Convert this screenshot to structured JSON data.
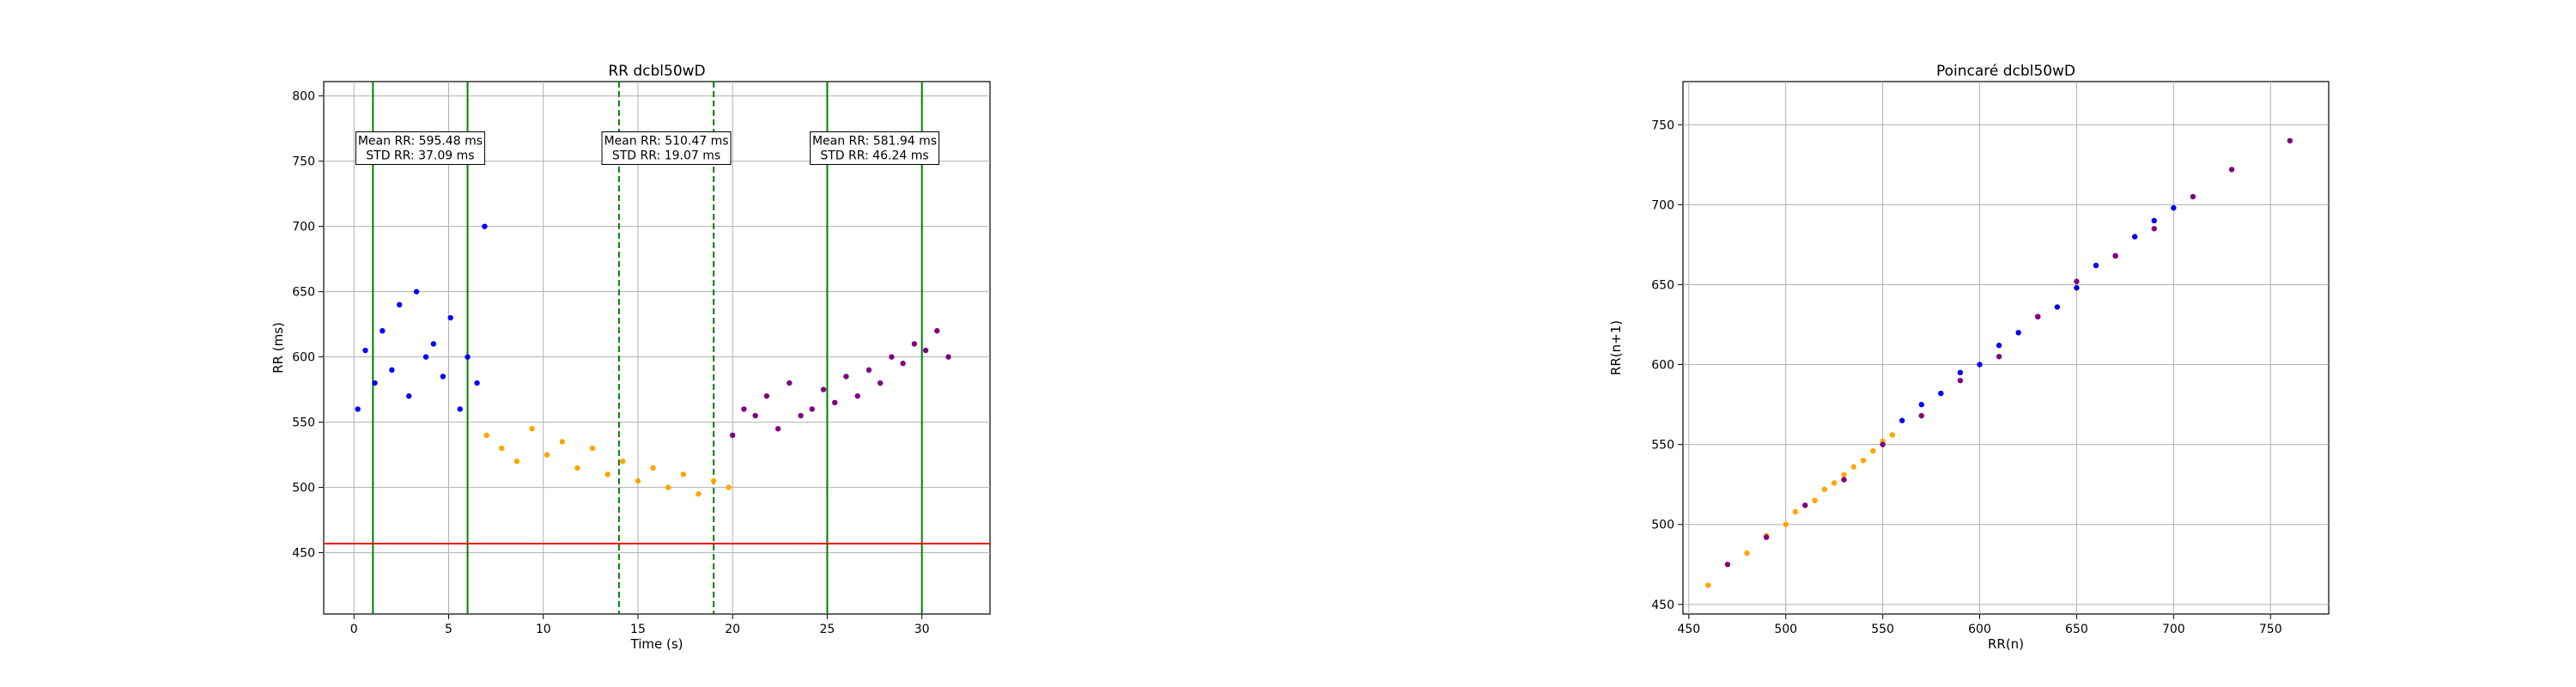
{
  "chart_data": [
    {
      "type": "scatter",
      "title": "RR dcbl50wD",
      "xlabel": "Time (s)",
      "ylabel": "RR (ms)",
      "xlim": [
        -1.6,
        33.6
      ],
      "ylim": [
        403,
        811
      ],
      "xticks": [
        0,
        5,
        10,
        15,
        20,
        25,
        30
      ],
      "yticks": [
        450,
        500,
        550,
        600,
        650,
        700,
        750,
        800
      ],
      "grid": true,
      "threshold_line": {
        "y": 457,
        "color": "#ff0000"
      },
      "vertical_lines": [
        {
          "x": 1,
          "style": "solid",
          "color": "#008000"
        },
        {
          "x": 6,
          "style": "solid",
          "color": "#008000"
        },
        {
          "x": 14,
          "style": "dashed",
          "color": "#008000"
        },
        {
          "x": 19,
          "style": "dashed",
          "color": "#008000"
        },
        {
          "x": 25,
          "style": "solid",
          "color": "#008000"
        },
        {
          "x": 30,
          "style": "solid",
          "color": "#008000"
        }
      ],
      "annotations": [
        {
          "x": 3.5,
          "y": 760,
          "lines": [
            "Mean RR: 595.48 ms",
            "STD RR: 37.09 ms"
          ]
        },
        {
          "x": 16.5,
          "y": 760,
          "lines": [
            "Mean RR: 510.47 ms",
            "STD RR: 19.07 ms"
          ]
        },
        {
          "x": 27.5,
          "y": 760,
          "lines": [
            "Mean RR: 581.94 ms",
            "STD RR: 46.24 ms"
          ]
        }
      ],
      "series": [
        {
          "color": "#0000ff",
          "x": [
            0.2,
            0.6,
            1.1,
            1.5,
            2.0,
            2.4,
            2.9,
            3.3,
            3.8,
            4.2,
            4.7,
            5.1,
            5.6,
            6.0,
            6.5,
            6.9
          ],
          "y": [
            560,
            605,
            580,
            620,
            590,
            640,
            570,
            650,
            600,
            610,
            585,
            630,
            560,
            600,
            580,
            700
          ]
        },
        {
          "color": "#ffa500",
          "x": [
            7.0,
            7.8,
            8.6,
            9.4,
            10.2,
            11.0,
            11.8,
            12.6,
            13.4,
            14.2,
            15.0,
            15.8,
            16.6,
            17.4,
            18.2,
            19.0,
            19.8
          ],
          "y": [
            540,
            530,
            520,
            545,
            525,
            535,
            515,
            530,
            510,
            520,
            505,
            515,
            500,
            510,
            495,
            505,
            500
          ]
        },
        {
          "color": "#800080",
          "x": [
            20.0,
            20.6,
            21.2,
            21.8,
            22.4,
            23.0,
            23.6,
            24.2,
            24.8,
            25.4,
            26.0,
            26.6,
            27.2,
            27.8,
            28.4,
            29.0,
            29.6,
            30.2,
            30.8,
            31.4
          ],
          "y": [
            540,
            560,
            555,
            570,
            545,
            580,
            555,
            560,
            575,
            565,
            585,
            570,
            590,
            580,
            600,
            595,
            610,
            605,
            620,
            600
          ]
        }
      ]
    },
    {
      "type": "scatter",
      "title": "Poincaré dcbl50wD",
      "xlabel": "RR(n)",
      "ylabel": "RR(n+1)",
      "xlim": [
        447,
        780
      ],
      "ylim": [
        444,
        777
      ],
      "xticks": [
        450,
        500,
        550,
        600,
        650,
        700,
        750
      ],
      "yticks": [
        450,
        500,
        550,
        600,
        650,
        700,
        750
      ],
      "grid": true,
      "series": [
        {
          "color": "#ffa500",
          "x": [
            460,
            470,
            480,
            490,
            500,
            505,
            510,
            515,
            520,
            525,
            530,
            535,
            540,
            545,
            550,
            555
          ],
          "y": [
            462,
            475,
            482,
            493,
            500,
            508,
            512,
            515,
            522,
            526,
            531,
            536,
            540,
            546,
            552,
            556
          ]
        },
        {
          "color": "#0000ff",
          "x": [
            560,
            570,
            580,
            590,
            600,
            610,
            620,
            630,
            640,
            650,
            660,
            670,
            680,
            690,
            700
          ],
          "y": [
            565,
            575,
            582,
            595,
            600,
            612,
            620,
            630,
            636,
            648,
            662,
            668,
            680,
            690,
            698
          ]
        },
        {
          "color": "#800080",
          "x": [
            470,
            490,
            510,
            530,
            550,
            570,
            590,
            610,
            630,
            650,
            670,
            690,
            710,
            730,
            760
          ],
          "y": [
            475,
            492,
            512,
            528,
            550,
            568,
            590,
            605,
            630,
            652,
            668,
            685,
            705,
            722,
            740
          ]
        }
      ]
    }
  ]
}
